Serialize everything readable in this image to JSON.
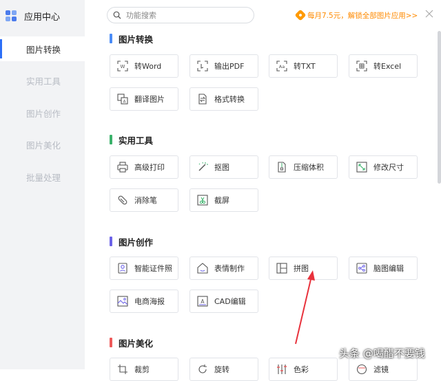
{
  "app": {
    "title": "应用中心"
  },
  "sidebar": {
    "items": [
      {
        "label": "图片转换",
        "active": true
      },
      {
        "label": "实用工具",
        "active": false
      },
      {
        "label": "图片创作",
        "active": false
      },
      {
        "label": "图片美化",
        "active": false
      },
      {
        "label": "批量处理",
        "active": false
      }
    ]
  },
  "search": {
    "placeholder": "功能搜索",
    "value": ""
  },
  "promo": {
    "text": "每月7.5元，解锁全部图片应用>>"
  },
  "sections": [
    {
      "title": "图片转换",
      "color": "#4a8cf7",
      "tools": [
        {
          "label": "转Word",
          "icon": "to-word-icon"
        },
        {
          "label": "输出PDF",
          "icon": "output-pdf-icon"
        },
        {
          "label": "转TXT",
          "icon": "to-txt-icon"
        },
        {
          "label": "转Excel",
          "icon": "to-excel-icon"
        },
        {
          "label": "翻译图片",
          "icon": "translate-image-icon"
        },
        {
          "label": "格式转换",
          "icon": "format-convert-icon"
        }
      ]
    },
    {
      "title": "实用工具",
      "color": "#3bb26b",
      "tools": [
        {
          "label": "高级打印",
          "icon": "printer-icon"
        },
        {
          "label": "抠图",
          "icon": "cutout-wand-icon"
        },
        {
          "label": "压缩体积",
          "icon": "compress-icon"
        },
        {
          "label": "修改尺寸",
          "icon": "resize-icon"
        },
        {
          "label": "消除笔",
          "icon": "eraser-icon"
        },
        {
          "label": "截屏",
          "icon": "screenshot-icon"
        }
      ]
    },
    {
      "title": "图片创作",
      "color": "#6c63e8",
      "tools": [
        {
          "label": "智能证件照",
          "icon": "id-photo-icon"
        },
        {
          "label": "表情制作",
          "icon": "emoji-maker-icon"
        },
        {
          "label": "拼图",
          "icon": "collage-icon"
        },
        {
          "label": "脑图编辑",
          "icon": "mindmap-icon"
        },
        {
          "label": "电商海报",
          "icon": "poster-icon"
        },
        {
          "label": "CAD编辑",
          "icon": "cad-icon"
        }
      ]
    },
    {
      "title": "图片美化",
      "color": "#ee5a5a",
      "tools": [
        {
          "label": "裁剪",
          "icon": "crop-icon"
        },
        {
          "label": "旋转",
          "icon": "rotate-icon"
        },
        {
          "label": "色彩",
          "icon": "color-adjust-icon"
        },
        {
          "label": "滤镜",
          "icon": "filter-icon"
        }
      ]
    }
  ],
  "watermark": {
    "text": "头条 @喝醋不要钱"
  },
  "colors": {
    "accent": "#2d6ff7",
    "promo": "#ff8a00",
    "annotation": "#e8323c"
  }
}
